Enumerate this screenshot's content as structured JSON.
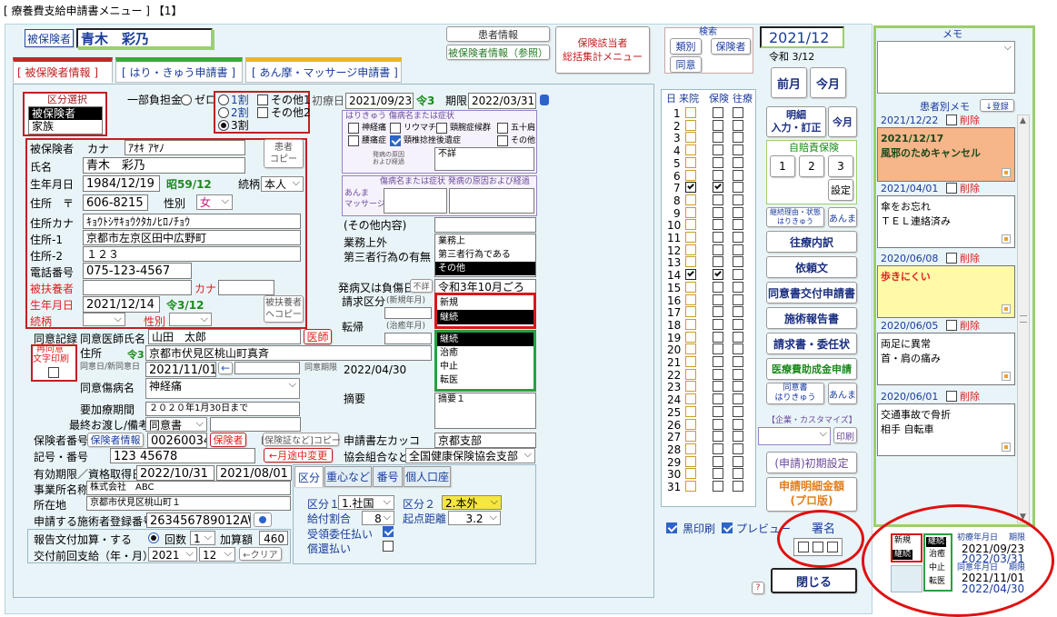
{
  "window_title": "[ 療養費支給申請書メニュー ]  【1】",
  "top": {
    "insured_label": "被保険者",
    "patient_name": "青木　彩乃",
    "patient_info_btn": "患者情報",
    "insured_ref_btn": "被保険者情報（参照）",
    "hoken_menu_btn": "保険該当者\n総括集計メニュー",
    "search_label": "検索",
    "search_btns": [
      "類別",
      "保険者",
      "同意"
    ],
    "date": "2021/12",
    "wareki": "令和 3/12",
    "prev_month": "前月",
    "this_month": "今月"
  },
  "tabs": [
    "被保険者情報",
    "はり・きゅう申請書",
    "あん摩・マッサージ申請書"
  ],
  "left": {
    "kubun_title": "区分選択",
    "kubun_items": [
      "被保険者",
      "家族"
    ],
    "ichibu_label": "一部負担金",
    "ratios": [
      "ゼロ",
      "1割",
      "2割",
      "3割"
    ],
    "other_checks": [
      "その他1",
      "その他2"
    ],
    "shoryo_label": "初療日",
    "shoryo_date": "2021/09/23",
    "shoryo_era": "令3",
    "kigen_label": "期限",
    "kigen_date": "2022/03/31",
    "hihokensha_label": "被保険者",
    "kana_label": "カナ",
    "kana": "ｱｵｷ ｱﾔﾉ",
    "copy_btn": "患者\nコピー",
    "name_label": "氏名",
    "name": "青木　彩乃",
    "birth_label": "生年月日",
    "birth": "1984/12/19",
    "birth_era": "昭59/12",
    "relation_label": "続柄",
    "relation": "本人",
    "address_label": "住所　〒",
    "postal": "606-8215",
    "sex_label": "性別",
    "sex": "女",
    "addr_kana_label": "住所カナ",
    "addr_kana": "ｷｮｳﾄｼｻｷｮｳｸﾀｶﾉﾋﾛﾉﾁｮｳ",
    "addr1_label": "住所-1",
    "addr1": "京都市左京区田中広野町",
    "addr2_label": "住所-2",
    "addr2": "１２３",
    "tel_label": "電話番号",
    "tel": "075-123-4567",
    "fuyo_label": "被扶養者",
    "fuyo_kana": "カナ",
    "fuyo_birth_label": "生年月日",
    "fuyo_birth": "2021/12/14",
    "fuyo_birth_era": "令3/12",
    "fuyo_copy": "被扶養者\nヘコピー",
    "fuyo_rel_label": "続柄",
    "fuyo_sex_label": "性別",
    "doui_kiroku": "同意記録",
    "doctor_label": "同意医師氏名",
    "doctor": "山田　太郎",
    "doctor_btn": "医師",
    "saido": "再同意\n文字印刷",
    "jusho_label": "住所",
    "jusho_era": "令3",
    "jusho": "京都市伏見区桃山町真斉",
    "doui_date_label": "同意日/新同意日",
    "doui_date": "2021/11/01",
    "doui_kigen_label": "同意期限",
    "doui_kigen": "2022/04/30",
    "byomei_label": "同意傷病名",
    "byomei": "神経痛",
    "yoka_label": "要加療期間",
    "yoka": "２０２０年1月30日まで",
    "saishu_label": "最終お渡し/備考",
    "saishu": "同意書",
    "hokensha_no_label": "保険者番号",
    "hokensha_no": "00260034",
    "hokensha_btn": "保険者",
    "hokensha_info_btn": "保険者情報",
    "hokensha_copy": "[保険証など]コピー",
    "kigo_label": "記号・番号",
    "kigo": "123 45678",
    "change_btn": "←月途中変更",
    "yuko_label": "有効期限／資格取得日",
    "yuko": "2022/10/31",
    "shikaku": "2021/08/01",
    "jigyo_label": "事業所名称",
    "jigyo": "株式会社　ABC",
    "shozai_label": "所在地",
    "shozai": "京都市伏見区桃山町１",
    "shisetsu_label": "申請する施術者登録番号",
    "shisetsu": "263456789012AW",
    "hokoku_label": "報告文付加算・する",
    "kaisu_label": "回数",
    "kaisu": "1",
    "kasan_label": "加算額",
    "kasan": "460",
    "kofu_label": "交付前回支給（年・月）",
    "kofu_year": "2021",
    "kofu_month": "12",
    "clear_btn": "←クリア"
  },
  "center": {
    "hari_title": "はりきゅう  傷病名または症状",
    "hari_checks": [
      "神経痛",
      "リウマチ",
      "頸腕症候群",
      "五十肩",
      "腰痛症",
      "頸椎捻挫後遺症",
      "その他"
    ],
    "hari_cause_label": "発病の原因\nおよび経過",
    "hari_cause": "不詳",
    "anma_title": "傷病名または症状  発病の原因および経過",
    "anma_label": "あんま\nマッサージ",
    "sonota_label": "(その他内容)",
    "gyomu_label": "業務上外",
    "daisansha_label": "第三者行為の有無",
    "gyomu_items": [
      "業務上",
      "第三者行為である",
      "その他"
    ],
    "hassyo_label": "発病又は負傷日",
    "fumei": "不詳",
    "hassyo": "令和3年10月ごろ",
    "seikyu_label": "請求区分",
    "seikyu_sub": "(新規年月)",
    "seikyu_items": [
      "新規",
      "継続"
    ],
    "tenki_label": "転帰",
    "tenki_sub": "(治癒年月)",
    "tenki_items": [
      "継続",
      "治癒",
      "中止",
      "転医"
    ],
    "tekiyo_label": "摘要",
    "tekiyo": "摘要１",
    "kakko_label": "申請書左カッコ",
    "kakko": "京都支部",
    "kyokai_label": "協会組合など",
    "kyokai": "全国健康保険協会支部",
    "subtabs": [
      "区分",
      "重心など",
      "番号",
      "個人口座"
    ],
    "kubun1_label": "区分１",
    "kubun1": "1.社国",
    "kubun2_label": "区分２",
    "kubun2": "2.本外",
    "kyufu_label": "給付割合",
    "kyufu": "8",
    "kiten_label": "起点距離",
    "kiten": "3.2",
    "juryo_label": "受領委任払い",
    "shokan_label": "償還払い"
  },
  "days": {
    "headers": [
      "日",
      "来院",
      "保険",
      "往療"
    ],
    "checked": [
      7,
      14
    ]
  },
  "right": {
    "meisai": "明細\n入力・訂正",
    "kongetsu": "今月",
    "jiko_title": "自賠責保険",
    "jiko_btns": [
      "1",
      "2",
      "3"
    ],
    "settei": "設定",
    "keizoku_btn": "継続理由・状態\nはりきゅう",
    "anma_btn": "あんま",
    "ouryo": "往療内訳",
    "irai": "依頼文",
    "doui_kofu": "同意書交付申請書",
    "sejutsu_hokoku": "施術報告書",
    "seikyu_inin": "請求書・委任状",
    "iryohi": "医療費助成金申請",
    "doui_hari": "同意書\nはりきゅう",
    "doui_anma": "あんま",
    "kigyo": "【企業・カスタマイズ】",
    "insatsu": "印刷",
    "shoki": "(申請)初期設定",
    "meisai_kin": "申請明細金額\n(プロ版)",
    "kuro": "黒印刷",
    "preview": "プレビュー",
    "shomei": "署名",
    "tojiru": "閉じる",
    "help": "?"
  },
  "memo": {
    "title": "メモ",
    "patient_memo": "患者別メモ",
    "toroku": "↓登録",
    "delete_label": "削除",
    "entries": [
      {
        "date": "2021/12/22",
        "text": "2021/12/17\n風邪のためキャンセル"
      },
      {
        "date": "2021/04/01",
        "text": "傘をお忘れ\nＴＥＬ連絡済み"
      },
      {
        "date": "2020/06/08",
        "text": "歩きにくい"
      },
      {
        "date": "2020/06/05",
        "text": "両足に異常\n首・肩の痛み"
      },
      {
        "date": "2020/06/01",
        "text": "交通事故で骨折\n相手 自転車"
      }
    ]
  },
  "bottom_summary": {
    "seikyu": [
      "新規",
      "継続"
    ],
    "tenki": [
      "継続",
      "治癒",
      "中止",
      "転医"
    ],
    "shoryo_label": "初療年月日",
    "kigen_label": "期限",
    "shoryo": "2021/09/23",
    "kigen": "2022/03/31",
    "doui_label": "同意年月日",
    "doui_kigen_label": "期限",
    "doui": "2021/11/01",
    "doui_kigen": "2022/04/30"
  },
  "colors": {
    "accent_green": "#9bd06a",
    "tab_red": "#c0282a",
    "tab_green": "#3ca83c",
    "tab_yellow": "#e8b820",
    "panel_bg": "#e9f4f8",
    "annotation_red": "#e01010"
  }
}
